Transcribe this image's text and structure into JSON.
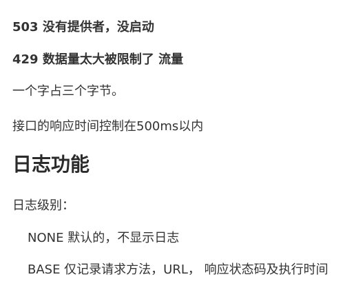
{
  "document": {
    "top_clipped_text": "",
    "line_503": "503 没有提供者，没启动",
    "line_429": "429 数据量太大被限制了 流量",
    "line_bytes": "一个字占三个字节。",
    "line_response_time": "接口的响应时间控制在500ms以内",
    "heading_logging": "日志功能",
    "line_log_level": "日志级别：",
    "level_none": "NONE 默认的，不显示日志",
    "level_basic": "BASE 仅记录请求方法，URL， 响应状态码及执行时间",
    "bottom_clipped_text": ""
  }
}
